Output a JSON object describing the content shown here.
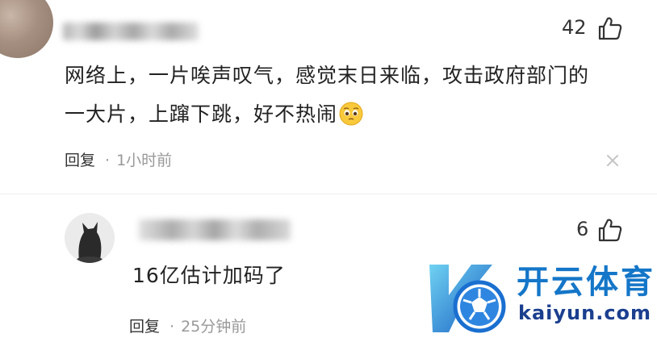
{
  "comment1": {
    "text_line1": "网络上，一片唉声叹气，感觉末日来临，攻击政府部门的",
    "text_line2": "一大片，上蹿下跳，好不热闹",
    "like_count": "42",
    "reply_label": "回复",
    "time": "1小时前",
    "emoji_icon": "pleading-face-icon"
  },
  "comment2": {
    "text": "16亿估计加码了",
    "like_count": "6",
    "reply_label": "回复",
    "time": "25分钟前"
  },
  "watermark": {
    "brand_cn": "开云体育",
    "brand_url": "kaiyun.com"
  },
  "colors": {
    "watermark_blue": "#1476c8",
    "watermark_dark": "#1b3f8f",
    "meta_gray": "#999999"
  }
}
